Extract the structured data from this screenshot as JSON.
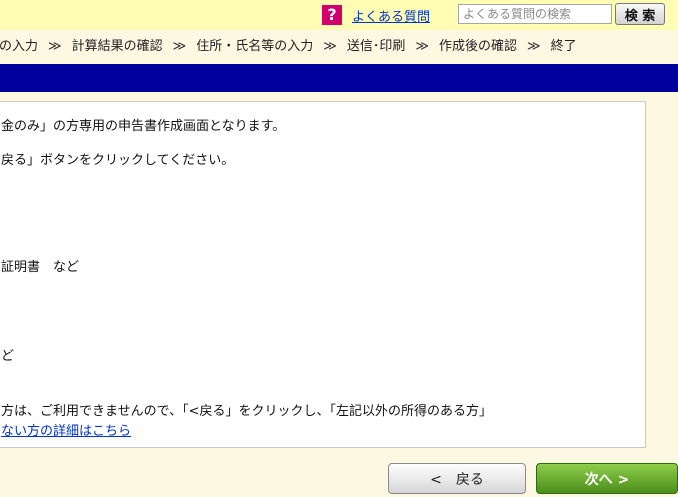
{
  "header": {
    "faq_icon": "?",
    "faq_link": "よくある質問",
    "search_placeholder": "よくある質問の検索",
    "search_button": "検 索"
  },
  "steps": {
    "items": [
      "等の入力",
      "計算結果の確認",
      "住所・氏名等の入力",
      "送信･印刷",
      "作成後の確認",
      "終了"
    ],
    "separator": "≫"
  },
  "content": {
    "line1": "金のみ」の方専用の申告書作成画面となります。",
    "line2": "戻る」ボタンをクリックしてください。",
    "line3": "証明書　など",
    "line4": "ど",
    "line5": "方は、ご利用できませんので、「<戻る」をクリックし、「左記以外の所得のある方」",
    "link": "ない方の詳細はこちら"
  },
  "footer": {
    "back_button": "<　戻る",
    "next_button": "次へ >"
  },
  "colors": {
    "top_bar": "#fffcb4",
    "nav_bar": "#00009c",
    "faq_icon": "#d0006f",
    "next_button": "#5a9e22"
  }
}
